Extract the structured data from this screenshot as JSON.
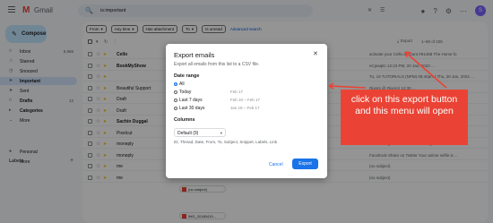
{
  "header": {
    "logo_letter": "M",
    "app_name": "Gmail",
    "search_value": "is:important",
    "avatar_letter": "S"
  },
  "sidebar": {
    "compose_label": "Compose",
    "items": [
      {
        "label": "Inbox",
        "count": "6,966",
        "icon": "inbox-icon"
      },
      {
        "label": "Starred",
        "count": "",
        "icon": "star-icon"
      },
      {
        "label": "Snoozed",
        "count": "",
        "icon": "clock-icon"
      },
      {
        "label": "Important",
        "count": "",
        "icon": "important-icon",
        "active": true
      },
      {
        "label": "Sent",
        "count": "",
        "icon": "send-icon"
      },
      {
        "label": "Drafts",
        "count": "12",
        "icon": "draft-icon"
      },
      {
        "label": "Categories",
        "count": "",
        "icon": "tag-icon"
      },
      {
        "label": "More",
        "count": "",
        "icon": "chevron-down-icon"
      }
    ],
    "labels_heading": "Labels",
    "label_items": [
      {
        "label": "Personal",
        "icon": "label-icon"
      },
      {
        "label": "More",
        "icon": "chevron-down-icon"
      }
    ]
  },
  "filters": {
    "chips": [
      "From",
      "Any time",
      "Has attachment",
      "To",
      "Is unread"
    ],
    "advanced_label": "Advanced search"
  },
  "toolbar": {
    "export_label": "Export",
    "page_count": "1–50 of 225"
  },
  "emails": [
    {
      "sender": "Cello",
      "unread": true,
      "snippet": "activate your Cello account #91458 The Home fo"
    },
    {
      "sender": "BookMyShow",
      "unread": true,
      "snippet": "eCjeaiptc 12:23 PM, 20 Jan, 2022 ..."
    },
    {
      "sender": "",
      "unread": false,
      "snippet": "Tu, 19 TUTORIALS (NPM) 06:40pm | Thu, 20 Jan, 2022 ..."
    },
    {
      "sender": "Beautiful Support",
      "unread": false,
      "snippet": "Rivers @ Rivers) 12:30 ..."
    },
    {
      "sender": "Draft",
      "unread": false,
      "snippet": ""
    },
    {
      "sender": "Draft",
      "unread": false,
      "snippet": ""
    },
    {
      "sender": "Sachin Duggal",
      "unread": true,
      "snippet": ""
    },
    {
      "sender": "Pixelcut",
      "unread": false,
      "snippet": "sizing automatically fits product photos..."
    },
    {
      "sender": "moneply",
      "unread": false,
      "snippet": "found using this email address. Sign in now ..."
    },
    {
      "sender": "moneply",
      "unread": false,
      "snippet": "Facebook Share on Twitter Your anime selfie is ..."
    },
    {
      "sender": "me",
      "unread": false,
      "snippet": "(no subject)"
    },
    {
      "sender": "me",
      "unread": false,
      "snippet": "(no subject)"
    }
  ],
  "attachments": [
    "(no subject)",
    "IMG_20180419..."
  ],
  "dialog": {
    "title": "Export emails",
    "subtitle": "Export all emails from this list to a CSV file.",
    "date_range_heading": "Date range",
    "options": [
      {
        "label": "All",
        "range": "",
        "selected": true
      },
      {
        "label": "Today",
        "range": "Feb 17",
        "selected": false
      },
      {
        "label": "Last 7 days",
        "range": "Feb 10 – Feb 17",
        "selected": false
      },
      {
        "label": "Last 30 days",
        "range": "Jan 18 – Feb 17",
        "selected": false
      }
    ],
    "columns_heading": "Columns",
    "columns_value": "Default (9)",
    "columns_list": "ID, Thread, Date, From, To, Subject, Snippet, Labels, Link",
    "cancel_label": "Cancel",
    "export_label": "Export"
  },
  "annotation": {
    "text": "click on this export button and this menu will open",
    "color": "#ea4335"
  }
}
